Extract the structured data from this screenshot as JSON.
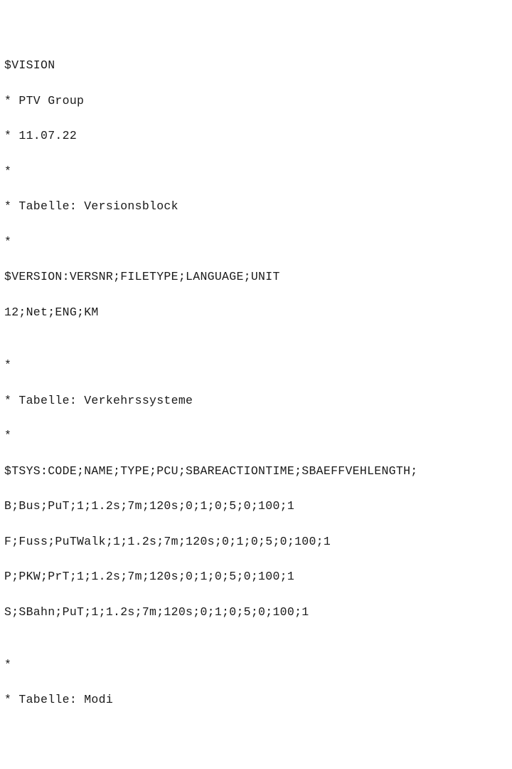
{
  "lines": [
    "$VISION",
    "* PTV Group",
    "* 11.07.22",
    "*",
    "* Tabelle: Versionsblock",
    "*",
    "$VERSION:VERSNR;FILETYPE;LANGUAGE;UNIT",
    "12;Net;ENG;KM",
    "",
    "*",
    "* Tabelle: Verkehrssysteme",
    "*",
    "$TSYS:CODE;NAME;TYPE;PCU;SBAREACTIONTIME;SBAEFFVEHLENGTH;",
    "B;Bus;PuT;1;1.2s;7m;120s;0;1;0;5;0;100;1",
    "F;Fuss;PuTWalk;1;1.2s;7m;120s;0;1;0;5;0;100;1",
    "P;PKW;PrT;1;1.2s;7m;120s;0;1;0;5;0;100;1",
    "S;SBahn;PuT;1;1.2s;7m;120s;0;1;0;5;0;100;1",
    "",
    "*",
    "* Tabelle: Modi"
  ]
}
